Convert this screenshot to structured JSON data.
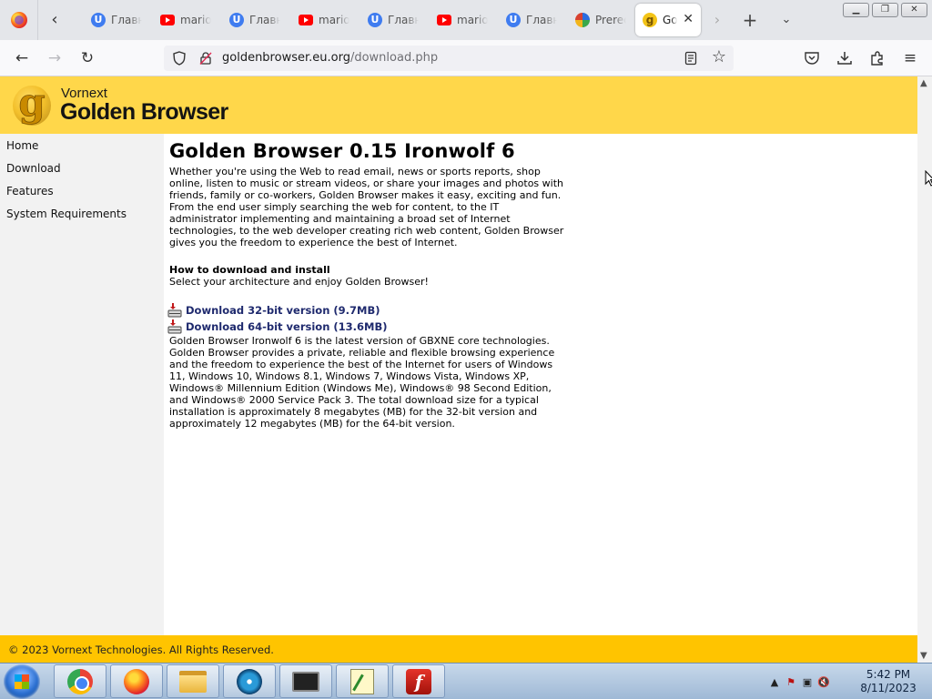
{
  "browser": {
    "tabs": [
      {
        "title": "Главн",
        "favicon": "u-icon"
      },
      {
        "title": "mario",
        "favicon": "youtube-icon"
      },
      {
        "title": "Главн",
        "favicon": "u-icon"
      },
      {
        "title": "mario",
        "favicon": "youtube-icon"
      },
      {
        "title": "Главн",
        "favicon": "u-icon"
      },
      {
        "title": "mario",
        "favicon": "youtube-icon"
      },
      {
        "title": "Главн",
        "favicon": "u-icon"
      },
      {
        "title": "Prerec",
        "favicon": "globe-icon"
      },
      {
        "title": "Go",
        "favicon": "golden-browser-icon",
        "active": true
      }
    ],
    "url": {
      "host": "goldenbrowser.eu.org",
      "path": "/download.php"
    }
  },
  "site": {
    "brand_small": "Vornext",
    "brand_big": "Golden Browser",
    "logo_letter": "g",
    "accent_color": "#ffd74a",
    "footer_color": "#ffc400",
    "link_color": "#1f2a6e",
    "nav": [
      {
        "label": "Home"
      },
      {
        "label": "Download"
      },
      {
        "label": "Features"
      },
      {
        "label": "System Requirements"
      }
    ],
    "title": "Golden Browser 0.15 Ironwolf 6",
    "intro_1": "Whether you're using the Web to read email, news or sports reports, shop online, listen to music or stream videos, or share your images and photos with friends, family or co-workers, Golden Browser makes it easy, exciting and fun.",
    "intro_2": "From the end user simply searching the web for content, to the IT administrator implementing and maintaining a broad set of Internet technologies, to the web developer creating rich web content, Golden Browser gives you the freedom to experience the best of Internet.",
    "howto_heading": "How to download and install",
    "howto_text": "Select your architecture and enjoy Golden Browser!",
    "downloads": [
      {
        "label": "Download 32-bit version (9.7MB)"
      },
      {
        "label": "Download 64-bit version (13.6MB)"
      }
    ],
    "description": "Golden Browser Ironwolf 6 is the latest version of GBXNE core technologies. Golden Browser provides a private, reliable and flexible browsing experience and the freedom to experience the best of the Internet for users of Windows 11, Windows 10, Windows 8.1, Windows 7, Windows Vista, Windows XP, Windows® Millennium Edition (Windows Me), Windows® 98 Second Edition, and Windows® 2000 Service Pack 3. The total download size for a typical installation is approximately 8 megabytes (MB) for the 32-bit version and approximately 12 megabytes (MB) for the 64-bit version.",
    "footer": "© 2023 Vornext Technologies. All Rights Reserved."
  },
  "taskbar": {
    "apps": [
      "chrome-icon",
      "firefox-icon",
      "file-explorer-icon",
      "media-player-icon",
      "terminal-icon",
      "notepad-icon",
      "flash-player-icon"
    ],
    "flash_glyph": "f",
    "clock_time": "5:42 PM",
    "clock_date": "8/11/2023"
  }
}
